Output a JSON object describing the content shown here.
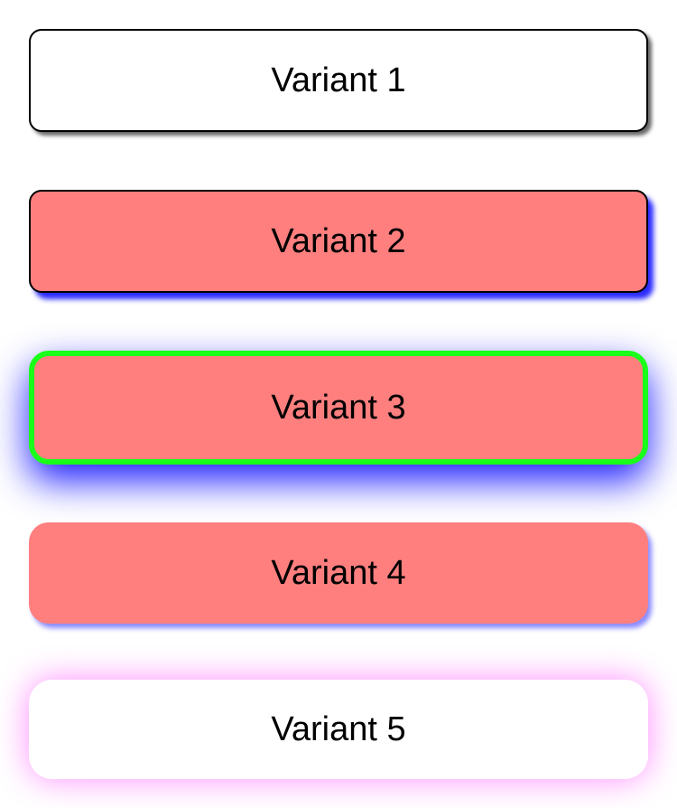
{
  "variants": [
    {
      "label": "Variant 1",
      "background": "#ffffff",
      "border": "#000000",
      "shadow": "#000000"
    },
    {
      "label": "Variant 2",
      "background": "#ff7f7f",
      "border": "#000000",
      "shadow": "#2b2bff"
    },
    {
      "label": "Variant 3",
      "background": "#ff7f7f",
      "border": "#1aff1a",
      "shadow": "#1f1fff"
    },
    {
      "label": "Variant 4",
      "background": "#ff7f7f",
      "border": "none",
      "shadow": "#8a8aff"
    },
    {
      "label": "Variant 5",
      "background": "#ffffff",
      "border": "none",
      "shadow": "#ff8cff"
    }
  ]
}
